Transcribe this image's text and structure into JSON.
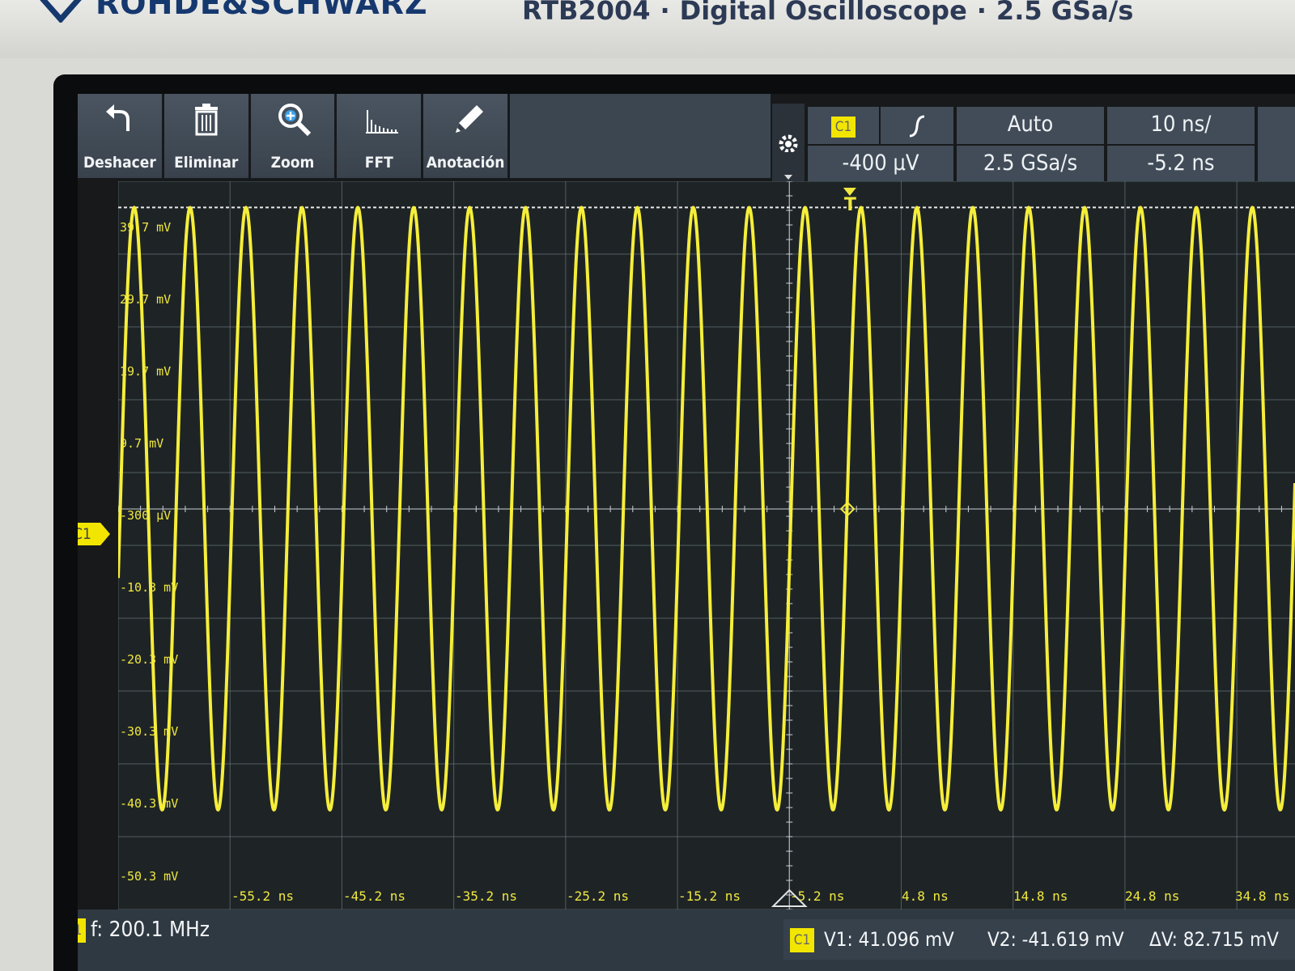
{
  "bezel": {
    "brand": "ROHDE&SCHWARZ",
    "model": "RTB2004",
    "product": "Digital Oscilloscope",
    "max_sample_rate": "2.5 GSa/s"
  },
  "toolbar": {
    "items": [
      {
        "label": "Deshacer",
        "icon": "undo-icon"
      },
      {
        "label": "Eliminar",
        "icon": "trash-icon"
      },
      {
        "label": "Zoom",
        "icon": "zoom-icon"
      },
      {
        "label": "FFT",
        "icon": "fft-icon"
      },
      {
        "label": "Anotación",
        "icon": "pencil-icon"
      }
    ]
  },
  "trigger": {
    "channel": "C1",
    "slope_icon": "rising-edge-icon",
    "level": "-400 µV",
    "mode": "Auto",
    "sample_rate": "2.5 GSa/s"
  },
  "horizontal": {
    "timebase": "10 ns/",
    "position": "-5.2 ns"
  },
  "channel_marker": "C1",
  "trigger_marker": "T",
  "y_axis": {
    "labels": [
      "39.7 mV",
      "29.7 mV",
      "19.7 mV",
      "9.7 mV",
      "-300 µV",
      "-10.3 mV",
      "-20.3 mV",
      "-30.3 mV",
      "-40.3 mV",
      "-50.3 mV"
    ]
  },
  "x_axis": {
    "labels": [
      "-55.2 ns",
      "-45.2 ns",
      "-35.2 ns",
      "-25.2 ns",
      "-15.2 ns",
      "-5.2 ns",
      "4.8 ns",
      "14.8 ns",
      "24.8 ns",
      "34.8 ns"
    ]
  },
  "waveform": {
    "color": "#f5ee3a",
    "frequency_mhz": 200.1,
    "v_max_mv": 41.096,
    "v_min_mv": -41.619,
    "t_start_ns": -65.2,
    "t_end_ns": 40.0,
    "v_top_mv": 44.7,
    "v_bottom_mv": -55.3
  },
  "status": {
    "channel": "C1",
    "frequency": "f: 200.1 MHz",
    "cursor_channel": "C1",
    "v1": "V1: 41.096 mV",
    "v2": "V2: -41.619 mV",
    "dv": "ΔV: 82.715 mV"
  }
}
